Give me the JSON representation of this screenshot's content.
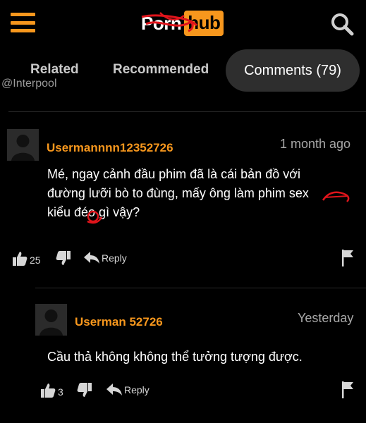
{
  "header": {
    "logo_left": "Porn",
    "logo_right": "hub",
    "icons": [
      "hamburger-menu-icon",
      "search-icon"
    ],
    "brand_color": "#f7971d"
  },
  "tabs": [
    {
      "label": "Related"
    },
    {
      "label": "Recommended"
    },
    {
      "label": "Comments (79)",
      "active": true
    }
  ],
  "watermark": "@Interpool",
  "comments": [
    {
      "username": "Usermannnn12352726",
      "time": "1 month ago",
      "text_lines": [
        "Mé, ngay cảnh đầu phim đã là cái bản đồ với",
        "đường lưỡi bò to đùng, mấy ông làm phim sex",
        "kiểu đéo gì vậy?"
      ],
      "likes": "25",
      "reply_label": "Reply"
    },
    {
      "username": "Userman 52726",
      "time": "Yesterday",
      "text_lines": [
        "Cầu thả không không thể tưởng tượng được."
      ],
      "likes": "3",
      "reply_label": "Reply"
    }
  ]
}
